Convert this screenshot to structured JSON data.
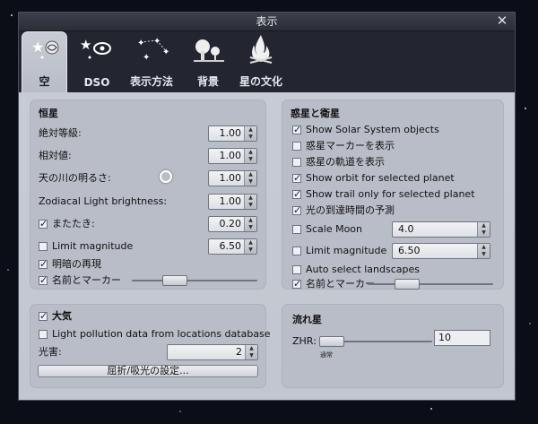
{
  "window": {
    "title": "表示"
  },
  "tabs": [
    {
      "label": "空",
      "icon": "sky-icon",
      "active": true
    },
    {
      "label": "DSO",
      "icon": "dso-icon",
      "active": false
    },
    {
      "label": "表示方法",
      "icon": "markings-icon",
      "active": false
    },
    {
      "label": "背景",
      "icon": "landscape-icon",
      "active": false
    },
    {
      "label": "星の文化",
      "icon": "starlore-icon",
      "active": false
    }
  ],
  "stars": {
    "title": "恒星",
    "absolute_scale": {
      "label": "絶対等級:",
      "value": "1.00"
    },
    "relative_scale": {
      "label": "相対値:",
      "value": "1.00"
    },
    "milky_way": {
      "label": "天の川の明るさ:",
      "value": "1.00"
    },
    "zodiacal_light": {
      "label": "Zodiacal Light brightness:",
      "value": "1.00"
    },
    "twinkle": {
      "label": "またたき:",
      "value": "0.20",
      "checked": true
    },
    "limit_magnitude": {
      "label": "Limit magnitude",
      "value": "6.50",
      "checked": false
    },
    "adaptation": {
      "label": "明暗の再現",
      "checked": true
    },
    "labels_markers": {
      "label": "名前とマーカー",
      "checked": true,
      "slider_value": 0.2
    }
  },
  "atmosphere": {
    "title": "大気",
    "checked": true,
    "light_pollution_db": {
      "label": "Light pollution data from locations database",
      "checked": false
    },
    "light_pollution": {
      "label": "光害:",
      "value": "2"
    },
    "refraction_button": "屈折/吸光の設定..."
  },
  "planets": {
    "title": "惑星と衛星",
    "items": [
      {
        "label": "Show Solar System objects",
        "checked": true
      },
      {
        "label": "惑星マーカーを表示",
        "checked": false
      },
      {
        "label": "惑星の軌道を表示",
        "checked": false
      },
      {
        "label": "Show orbit for selected planet",
        "checked": true
      },
      {
        "label": "Show trail only for selected planet",
        "checked": true
      },
      {
        "label": "光の到達時間の予測",
        "checked": true
      }
    ],
    "scale_moon": {
      "label": "Scale Moon",
      "value": "4.0",
      "checked": false
    },
    "limit_magnitude": {
      "label": "Limit magnitude",
      "value": "6.50",
      "checked": false
    },
    "auto_landscapes": {
      "label": "Auto select landscapes",
      "checked": false
    },
    "labels_markers": {
      "label": "名前とマーカー",
      "checked": true,
      "slider_value": 0.45
    }
  },
  "meteors": {
    "title": "流れ星",
    "zhr_label": "ZHR:",
    "zhr_value": "10",
    "speed_label": "通常",
    "slider_value": 0.02
  },
  "colors": {
    "background": "#0b0e16",
    "panel": "#c7cbd3",
    "group": "#b9bdc7"
  }
}
